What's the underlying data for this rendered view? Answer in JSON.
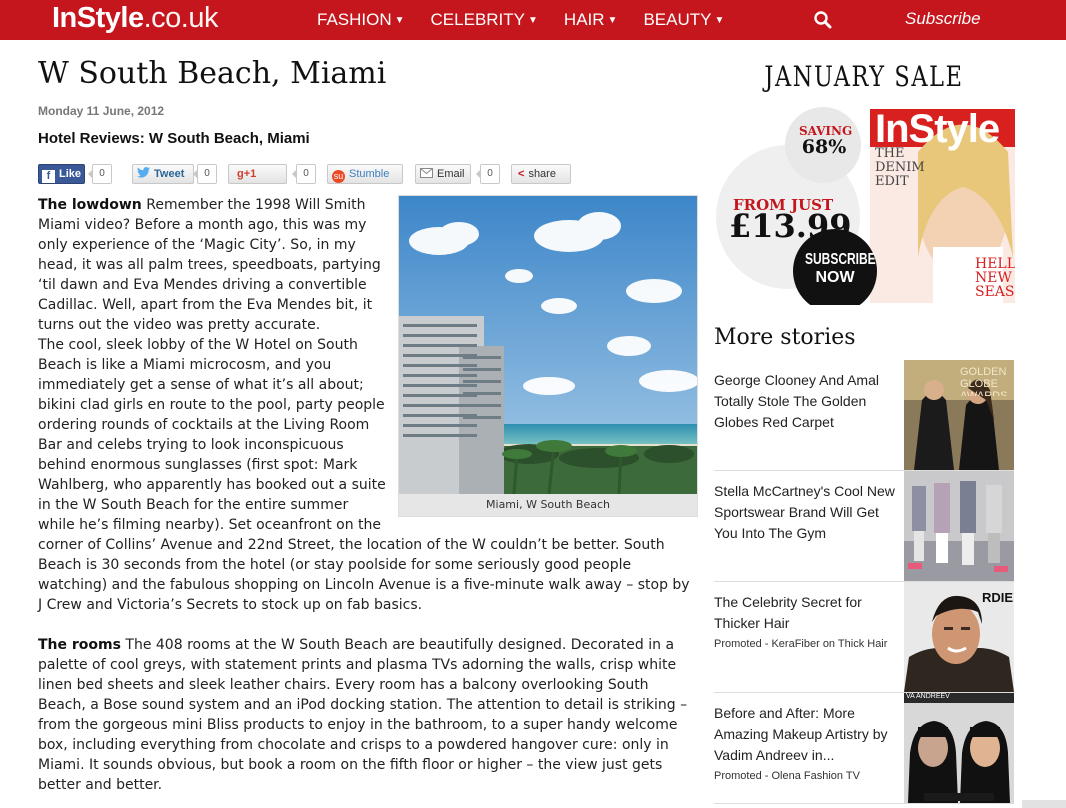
{
  "header": {
    "logo_brand": "InStyle",
    "logo_tld": ".co.uk",
    "nav": [
      "FASHION",
      "CELEBRITY",
      "HAIR",
      "BEAUTY"
    ],
    "subscribe": "Subscribe",
    "search_icon": "search-icon",
    "colors": {
      "bar": "#c4161c"
    }
  },
  "article": {
    "title": "W South Beach, Miami",
    "date": "Monday 11 June, 2012",
    "subtitle": "Hotel Reviews: W South Beach, Miami",
    "share": {
      "like": "Like",
      "like_count": "0",
      "tweet": "Tweet",
      "tweet_count": "0",
      "gplus": "+1",
      "gplus_count": "0",
      "stumble": "Stumble",
      "email": "Email",
      "email_count": "0",
      "share": "share"
    },
    "image_caption": "Miami, W South Beach",
    "sections": [
      {
        "heading": "The lowdown",
        "paragraphs": [
          "Remember the 1998 Will Smith Miami video? Before a month ago, this was my only experience of the ‘Magic City’. So, in my head, it was all palm trees, speedboats, partying ‘til dawn and Eva Mendes driving a convertible Cadillac. Well, apart from the Eva Mendes bit, it turns out the video was pretty accurate.",
          "The cool, sleek lobby of the W Hotel on South Beach is like a Miami microcosm, and you immediately get a sense of what it’s all about; bikini clad girls en route to the pool, party people ordering rounds of cocktails at the Living Room Bar and celebs trying to look inconspicuous behind enormous sunglasses (first spot: Mark Wahlberg, who apparently has booked out a suite in the W South Beach for the entire summer while he’s filming nearby). Set oceanfront on the corner of Collins’ Avenue and 22nd Street, the location of the W couldn’t be better. South Beach is 30 seconds from the hotel (or stay poolside for some seriously good people watching) and the fabulous shopping on Lincoln Avenue is a five-minute walk away – stop by J Crew and Victoria’s Secrets to stock up on fab basics."
        ]
      },
      {
        "heading": "The rooms",
        "paragraphs": [
          "The 408 rooms at the W South Beach are beautifully designed. Decorated in a palette of cool greys, with statement prints and plasma TVs adorning the walls, crisp white linen bed sheets and sleek leather chairs. Every room has a balcony overlooking South Beach, a Bose sound system and an iPod docking station. The attention to detail is striking – from the gorgeous mini Bliss products to enjoy in the bathroom, to a super handy welcome box, including everything from chocolate and crisps to a powdered hangover cure: only in Miami. It sounds obvious, but book a room on the fifth floor or higher – the view just gets better and better."
        ]
      }
    ]
  },
  "sidebar": {
    "ad": {
      "title": "JANUARY SALE",
      "saving_label": "SAVING",
      "saving_value": "68%",
      "from_label": "FROM JUST",
      "price": "£13.99",
      "cta_line1": "SUBSCRIBE",
      "cta_line2": "NOW",
      "cover_text": "InStyle",
      "cover_line1": "THE",
      "cover_line2": "DENIM",
      "cover_line3": "EDIT",
      "cover_corner1": "HELLO",
      "cover_corner2": "NEW",
      "cover_corner3": "SEASON"
    },
    "more_title": "More stories",
    "stories": [
      {
        "title": "George Clooney And Amal Totally Stole The Golden Globes Red Carpet",
        "promo": "",
        "image_text": "GOLDEN GLOBE AWARDS"
      },
      {
        "title": "Stella McCartney's Cool New Sportswear Brand Will Get You Into The Gym",
        "promo": "",
        "image_text": ""
      },
      {
        "title": "The Celebrity Secret for Thicker Hair",
        "promo": "Promoted - KeraFiber on Thick Hair",
        "image_text": "RDIE"
      },
      {
        "title": "Before and After: More Amazing Makeup Artistry by Vadim Andreev in...",
        "promo": "Promoted - Olena Fashion TV",
        "image_text": "VA ANDREEV"
      }
    ]
  }
}
